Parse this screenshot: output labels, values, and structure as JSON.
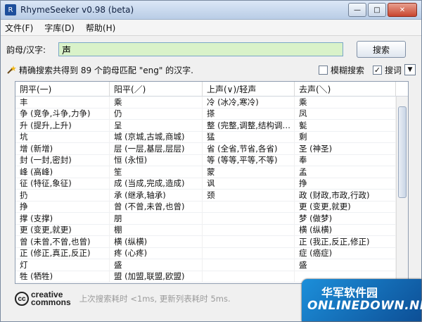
{
  "window": {
    "title": "RhymeSeeker v0.98 (beta)",
    "icon_label": "R"
  },
  "window_buttons": {
    "minimize": "—",
    "maximize": "□",
    "close": "✕"
  },
  "menu": [
    "文件(F)",
    "字库(D)",
    "帮助(H)"
  ],
  "search": {
    "label": "韵母/汉字:",
    "value": "声",
    "button": "搜索"
  },
  "status": {
    "text": "精确搜索共得到 89 个韵母匹配 \"eng\" 的汉字."
  },
  "options": {
    "fuzzy_label": "模糊搜索",
    "fuzzy_checked": false,
    "word_label": "搜词",
    "word_checked": true,
    "dropdown": "▼"
  },
  "table": {
    "headers": [
      "阴平(一)",
      "阳平(／)",
      "上声(∨)/轻声",
      "去声(＼)"
    ],
    "rows": [
      [
        "丰",
        "乘",
        "冷 (冰冷,寒冷)",
        "乘"
      ],
      [
        "争 (竞争,斗争,力争)",
        "仍",
        "搽",
        "凤"
      ],
      [
        "升 (提升,上升)",
        "呈",
        "整 (完整,调整,结构调…",
        "甏"
      ],
      [
        "坑",
        "城 (京城,古城,商城)",
        "猛",
        "剩"
      ],
      [
        "增 (新增)",
        "层 (一层,基层,层层)",
        "省 (全省,节省,各省)",
        "圣 (神圣)"
      ],
      [
        "封 (一封,密封)",
        "恒 (永恒)",
        "等 (等等,平等,不等)",
        "奉"
      ],
      [
        "峰 (高峰)",
        "笙",
        "蒙",
        "孟"
      ],
      [
        "征 (特征,象征)",
        "成 (当成,完成,造成)",
        "讽",
        "挣"
      ],
      [
        "扔",
        "承 (继承,轴承)",
        "颈",
        "政 (财政,市政,行政)"
      ],
      [
        "挣",
        "曾 (不曾,未曾,也曾)",
        "",
        "更 (变更,就更)"
      ],
      [
        "撑 (支撑)",
        "朋",
        "",
        "梦 (做梦)"
      ],
      [
        "更 (变更,就更)",
        "棚",
        "",
        "横 (纵横)"
      ],
      [
        "曾 (未曾,不曾,也曾)",
        "横 (纵横)",
        "",
        "正 (我正,反正,修正)"
      ],
      [
        "正 (修正,真正,反正)",
        "疼 (心疼)",
        "",
        "症 (癌症)"
      ],
      [
        "灯",
        "盛",
        "",
        "盛"
      ],
      [
        "牲 (牺牲)",
        "盟 (加盟,联盟,欧盟)",
        "",
        ""
      ]
    ]
  },
  "footer": {
    "logo_top": "creative",
    "logo_bottom": "commons",
    "logo_mark": "cc",
    "text": "上次搜索耗时 <1ms, 更新列表耗时 5ms."
  },
  "watermark": {
    "top": "华军软件园",
    "bottom": "ONLINEDOWN.NET"
  }
}
